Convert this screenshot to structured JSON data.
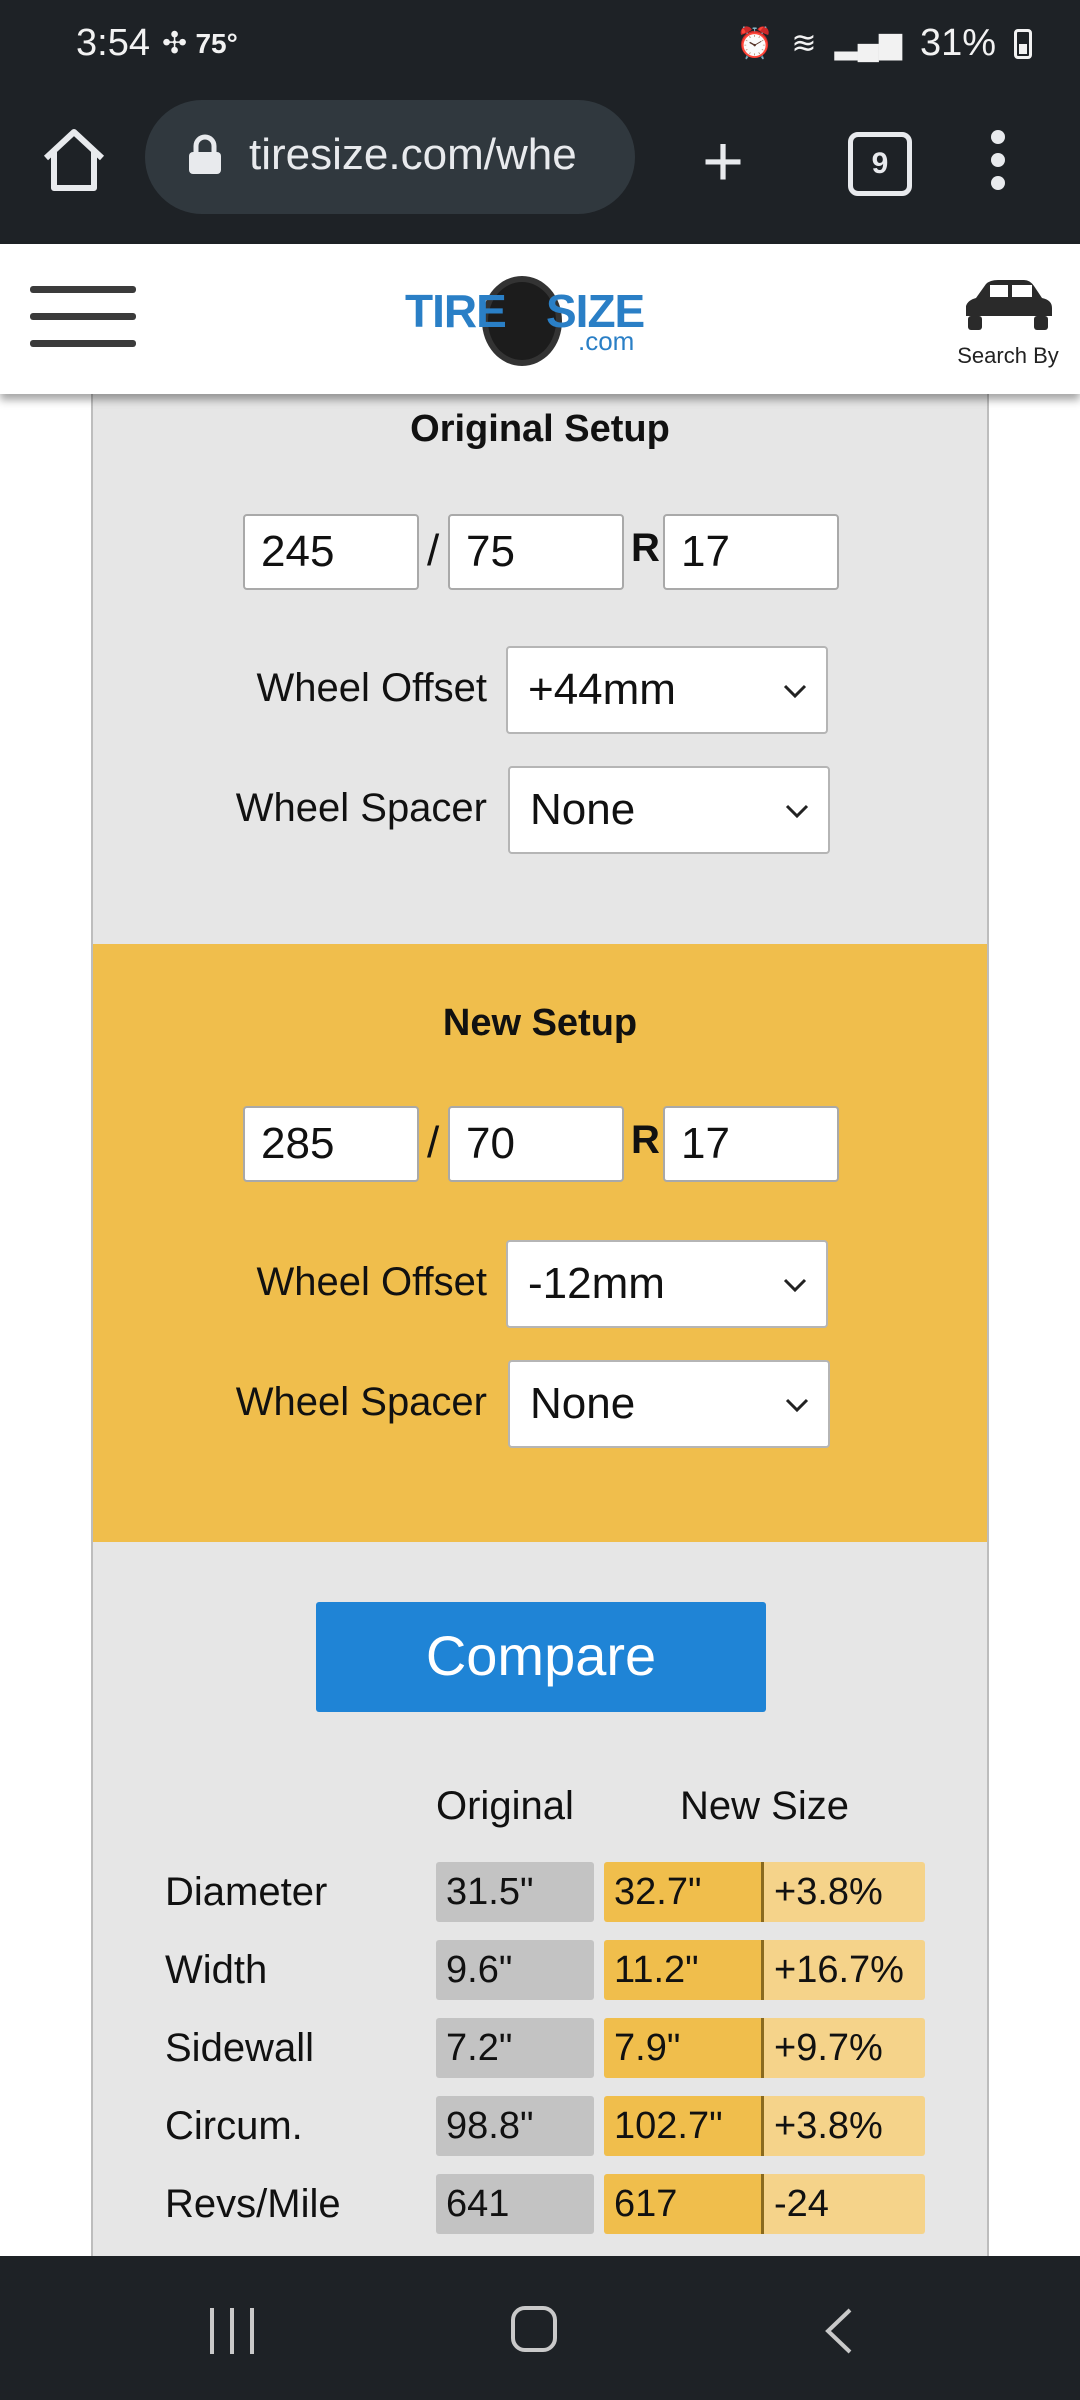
{
  "status_bar": {
    "time": "3:54",
    "temperature": "75°",
    "battery": "31%"
  },
  "browser": {
    "url": "tiresize.com/whe",
    "tab_count": "9"
  },
  "header": {
    "logo_tire": "TIRE",
    "logo_size": "SIZE",
    "logo_com": ".com",
    "search_by": "Search By"
  },
  "original_setup": {
    "title": "Original Setup",
    "width": "245",
    "aspect": "75",
    "rim": "17",
    "wheel_offset_label": "Wheel Offset",
    "wheel_offset": "+44mm",
    "wheel_spacer_label": "Wheel Spacer",
    "wheel_spacer": "None"
  },
  "new_setup": {
    "title": "New Setup",
    "width": "285",
    "aspect": "70",
    "rim": "17",
    "wheel_offset_label": "Wheel Offset",
    "wheel_offset": "-12mm",
    "wheel_spacer_label": "Wheel Spacer",
    "wheel_spacer": "None"
  },
  "separators": {
    "slash": "/",
    "r": "R"
  },
  "compare_label": "Compare",
  "results": {
    "col_original": "Original",
    "col_new": "New Size",
    "rows": [
      {
        "label": "Diameter",
        "original": "31.5\"",
        "new": "32.7\"",
        "diff": "+3.8%"
      },
      {
        "label": "Width",
        "original": "9.6\"",
        "new": "11.2\"",
        "diff": "+16.7%"
      },
      {
        "label": "Sidewall",
        "original": "7.2\"",
        "new": "7.9\"",
        "diff": "+9.7%"
      },
      {
        "label": "Circum.",
        "original": "98.8\"",
        "new": "102.7\"",
        "diff": "+3.8%"
      },
      {
        "label": "Revs/Mile",
        "original": "641",
        "new": "617",
        "diff": "-24"
      }
    ]
  },
  "colors": {
    "accent_blue": "#1f84d6",
    "new_setup_bg": "#f0be4c",
    "panel_bg": "#e6e6e6"
  }
}
